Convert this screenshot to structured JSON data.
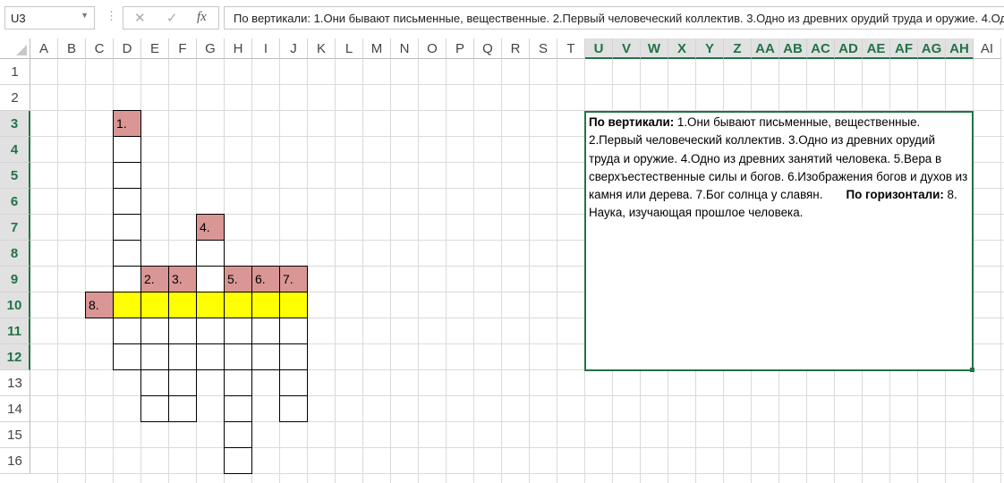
{
  "formula_bar": {
    "name_box": "U3",
    "cancel_icon": "✕",
    "enter_icon": "✓",
    "fx_label": "fx",
    "formula": "По вертикали: 1.Они бывают письменные, вещественные. 2.Первый человеческий коллектив. 3.Одно из древних орудий труда и оружие. 4.Одно из древних занятий человека. 5.Вера в сверхъестественные силы и богов. 6.Изображения богов и духов из камня или дерева. 7.Бог солнца у славян.       По горизонтали: 8. Наука, изучающая прошлое человека."
  },
  "columns": [
    "A",
    "B",
    "C",
    "D",
    "E",
    "F",
    "G",
    "H",
    "I",
    "J",
    "K",
    "L",
    "M",
    "N",
    "O",
    "P",
    "Q",
    "R",
    "S",
    "T",
    "U",
    "V",
    "W",
    "X",
    "Y",
    "Z",
    "AA",
    "AB",
    "AC",
    "AD",
    "AE",
    "AF",
    "AG",
    "AH",
    "AI"
  ],
  "selected_columns": [
    "U",
    "V",
    "W",
    "X",
    "Y",
    "Z",
    "AA",
    "AB",
    "AC",
    "AD",
    "AE",
    "AF",
    "AG",
    "AH"
  ],
  "rows": [
    "1",
    "2",
    "3",
    "4",
    "5",
    "6",
    "7",
    "8",
    "9",
    "10",
    "11",
    "12",
    "13",
    "14",
    "15",
    "16"
  ],
  "selected_rows": [
    "3",
    "4",
    "5",
    "6",
    "7",
    "8",
    "9",
    "10",
    "11",
    "12"
  ],
  "colors": {
    "pink": "#da9694",
    "yellow": "#ffff00",
    "accent": "#217346"
  },
  "crossword": [
    {
      "ref": "D3",
      "label": "1.",
      "fill": "pink"
    },
    {
      "ref": "D4"
    },
    {
      "ref": "D5"
    },
    {
      "ref": "D6"
    },
    {
      "ref": "D7"
    },
    {
      "ref": "D8"
    },
    {
      "ref": "D9"
    },
    {
      "ref": "G7",
      "label": "4.",
      "fill": "pink"
    },
    {
      "ref": "G8"
    },
    {
      "ref": "G9"
    },
    {
      "ref": "E9",
      "label": "2.",
      "fill": "pink"
    },
    {
      "ref": "F9",
      "label": "3.",
      "fill": "pink"
    },
    {
      "ref": "H9",
      "label": "5.",
      "fill": "pink"
    },
    {
      "ref": "I9",
      "label": "6.",
      "fill": "pink"
    },
    {
      "ref": "J9",
      "label": "7.",
      "fill": "pink"
    },
    {
      "ref": "C10",
      "label": "8.",
      "fill": "pink"
    },
    {
      "ref": "D10",
      "fill": "yellow"
    },
    {
      "ref": "E10",
      "fill": "yellow"
    },
    {
      "ref": "F10",
      "fill": "yellow"
    },
    {
      "ref": "G10",
      "fill": "yellow"
    },
    {
      "ref": "H10",
      "fill": "yellow"
    },
    {
      "ref": "I10",
      "fill": "yellow"
    },
    {
      "ref": "J10",
      "fill": "yellow"
    },
    {
      "ref": "D11"
    },
    {
      "ref": "E11"
    },
    {
      "ref": "F11"
    },
    {
      "ref": "G11"
    },
    {
      "ref": "H11"
    },
    {
      "ref": "I11"
    },
    {
      "ref": "J11"
    },
    {
      "ref": "D12"
    },
    {
      "ref": "E12"
    },
    {
      "ref": "F12"
    },
    {
      "ref": "G12"
    },
    {
      "ref": "H12"
    },
    {
      "ref": "I12"
    },
    {
      "ref": "J12"
    },
    {
      "ref": "E13"
    },
    {
      "ref": "F13"
    },
    {
      "ref": "H13"
    },
    {
      "ref": "J13"
    },
    {
      "ref": "E14"
    },
    {
      "ref": "F14"
    },
    {
      "ref": "H14"
    },
    {
      "ref": "J14"
    },
    {
      "ref": "H15"
    },
    {
      "ref": "H16"
    }
  ],
  "textbox": {
    "vertical_heading": "По вертикали:",
    "vertical_text": " 1.Они бывают письменные, вещественные. 2.Первый человеческий коллектив. 3.Одно из древних орудий труда и оружие. 4.Одно из древних занятий человека. 5.Вера в сверхъестественные силы и богов. 6.Изображения богов и духов из камня или дерева. 7.Бог солнца у славян.       ",
    "horizontal_heading": "По горизонтали:",
    "horizontal_text": " 8. Наука, изучающая прошлое человека."
  }
}
